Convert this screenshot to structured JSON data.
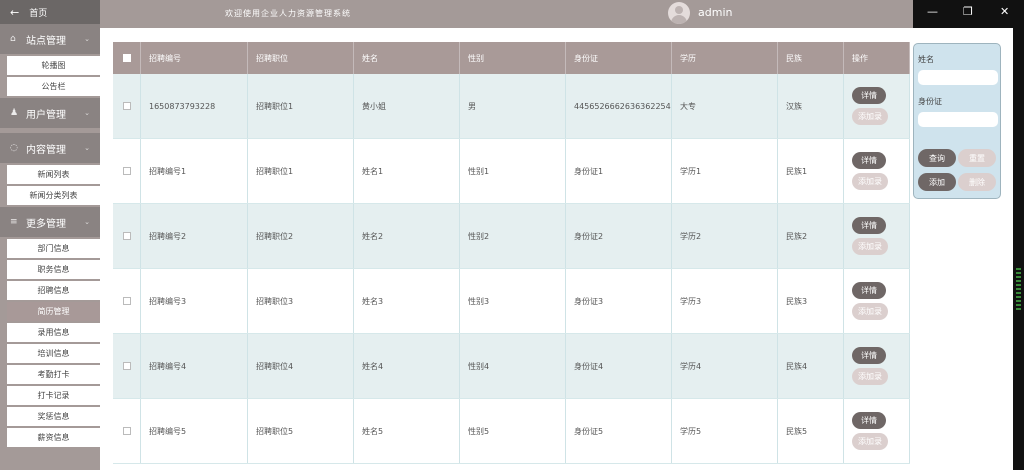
{
  "topbar": {
    "welcome": "欢迎使用企业人力资源管理系统",
    "username": "admin"
  },
  "sidebar": {
    "home": "首页",
    "sections": [
      {
        "label": "站点管理",
        "items": [
          {
            "label": "轮播图"
          },
          {
            "label": "公告栏"
          }
        ]
      },
      {
        "label": "用户管理",
        "items": []
      },
      {
        "label": "内容管理",
        "items": [
          {
            "label": "新闻列表"
          },
          {
            "label": "新闻分类列表"
          }
        ]
      },
      {
        "label": "更多管理",
        "items": [
          {
            "label": "部门信息"
          },
          {
            "label": "职务信息"
          },
          {
            "label": "招聘信息"
          },
          {
            "label": "简历管理",
            "active": true
          },
          {
            "label": "录用信息"
          },
          {
            "label": "培训信息"
          },
          {
            "label": "考勤打卡"
          },
          {
            "label": "打卡记录"
          },
          {
            "label": "奖惩信息"
          },
          {
            "label": "薪资信息"
          }
        ]
      }
    ]
  },
  "table": {
    "headers": [
      "招聘编号",
      "招聘职位",
      "姓名",
      "性别",
      "身份证",
      "学历",
      "民族",
      "操作"
    ],
    "rows": [
      [
        "1650873793228",
        "招聘职位1",
        "黄小姐",
        "男",
        "445652666263636225​4",
        "大专",
        "汉族"
      ],
      [
        "招聘编号1",
        "招聘职位1",
        "姓名1",
        "性别1",
        "身份证1",
        "学历1",
        "民族1"
      ],
      [
        "招聘编号2",
        "招聘职位2",
        "姓名2",
        "性别2",
        "身份证2",
        "学历2",
        "民族2"
      ],
      [
        "招聘编号3",
        "招聘职位3",
        "姓名3",
        "性别3",
        "身份证3",
        "学历3",
        "民族3"
      ],
      [
        "招聘编号4",
        "招聘职位4",
        "姓名4",
        "性别4",
        "身份证4",
        "学历4",
        "民族4"
      ],
      [
        "招聘编号5",
        "招聘职位5",
        "姓名5",
        "性别5",
        "身份证5",
        "学历5",
        "民族5"
      ]
    ],
    "detail_label": "详情",
    "add_label": "添加录"
  },
  "search": {
    "name_label": "姓名",
    "name_value": "",
    "idcard_label": "身份证",
    "idcard_value": "",
    "query_label": "查询",
    "reset_label": "重置",
    "add_label": "添加",
    "delete_label": "删除"
  },
  "colors": {
    "sidebar_bg": "#a49a98",
    "section_bg": "#8a8382",
    "header_bg": "#a99a98",
    "row_alt": "#e5eff0",
    "button_dark": "#6f6766",
    "button_light": "#dbcfce",
    "search_panel": "#cfe3ed"
  },
  "icons": [
    "back-arrow-icon",
    "home-icon",
    "user-icon",
    "chat-icon",
    "list-icon",
    "chevron-down-icon",
    "avatar-icon",
    "minimize-icon",
    "restore-icon",
    "close-icon"
  ]
}
